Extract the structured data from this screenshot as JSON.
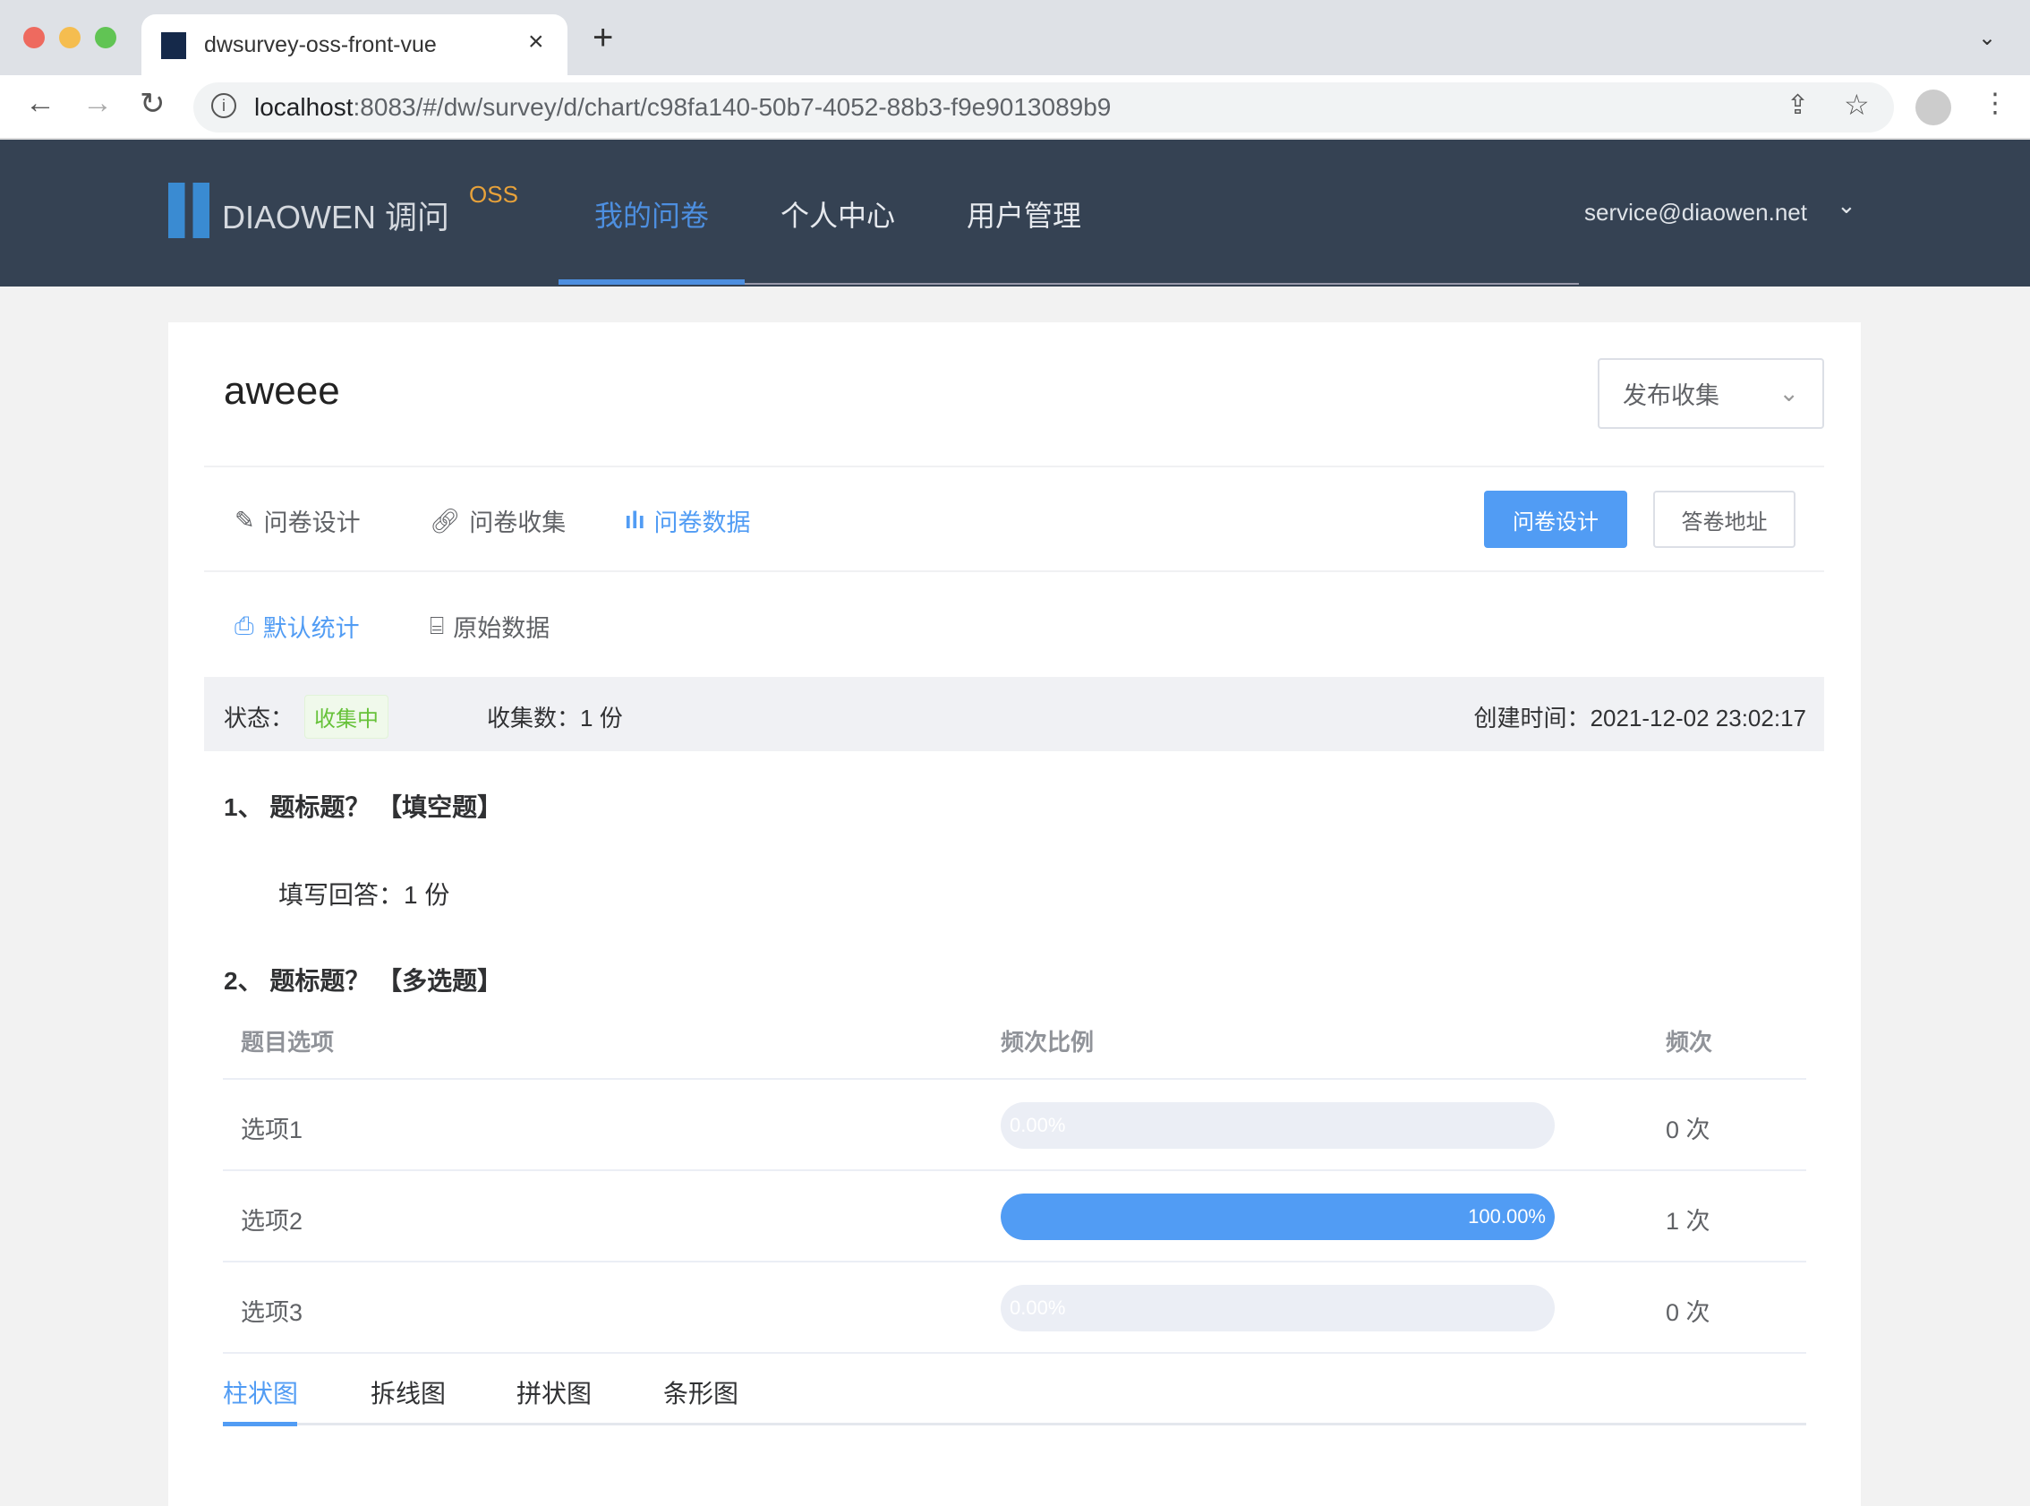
{
  "browser": {
    "tab_title": "dwsurvey-oss-front-vue",
    "url_host": "localhost",
    "url_rest": ":8083/#/dw/survey/d/chart/c98fa140-50b7-4052-88b3-f9e9013089b9"
  },
  "header": {
    "logo_text": "DIAOWEN 调问",
    "logo_badge": "OSS",
    "nav": [
      {
        "label": "我的问卷",
        "active": true
      },
      {
        "label": "个人中心"
      },
      {
        "label": "用户管理"
      }
    ],
    "user": "service@diaowen.net"
  },
  "survey": {
    "title": "aweee",
    "publish_label": "发布收集",
    "tabs": [
      {
        "label": "问卷设计",
        "icon": "edit-icon"
      },
      {
        "label": "问卷收集",
        "icon": "link-icon"
      },
      {
        "label": "问卷数据",
        "icon": "bar-chart-icon",
        "active": true
      }
    ],
    "design_button": "问卷设计",
    "answer_url_button": "答卷地址",
    "subtabs": [
      {
        "label": "默认统计",
        "active": true
      },
      {
        "label": "原始数据"
      }
    ],
    "status_label": "状态：",
    "status_value": "收集中",
    "count_label": "收集数：",
    "count_value": "1 份",
    "created_label": "创建时间：",
    "created_value": "2021-12-02 23:02:17"
  },
  "questions": [
    {
      "title": "1、 题标题？ 【填空题】",
      "answer_label": "填写回答：",
      "answer_value": "1 份"
    },
    {
      "title": "2、 题标题？ 【多选题】",
      "columns": [
        "题目选项",
        "频次比例",
        "频次"
      ],
      "rows": [
        {
          "option": "选项1",
          "percent": 0,
          "percent_label": "0.00%",
          "count": "0 次"
        },
        {
          "option": "选项2",
          "percent": 100,
          "percent_label": "100.00%",
          "count": "1 次"
        },
        {
          "option": "选项3",
          "percent": 0,
          "percent_label": "0.00%",
          "count": "0 次"
        }
      ],
      "chart_tabs": [
        {
          "label": "柱状图",
          "active": true
        },
        {
          "label": "拆线图"
        },
        {
          "label": "拼状图"
        },
        {
          "label": "条形图"
        }
      ]
    }
  ],
  "colors": {
    "accent": "#519cf4",
    "nav_bg": "#354253",
    "success": "#67c23a"
  }
}
